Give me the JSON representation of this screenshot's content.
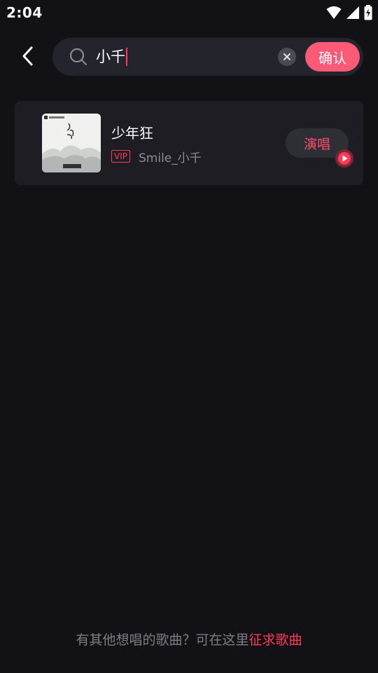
{
  "status_bar": {
    "time": "2:04"
  },
  "search": {
    "query": "小千",
    "confirm_label": "确认"
  },
  "results": [
    {
      "title": "少年狂",
      "vip_label": "VIP",
      "artist": "Smile_小千",
      "sing_label": "演唱"
    }
  ],
  "footer": {
    "prompt": "有其他想唱的歌曲？可在这里",
    "link": "征求歌曲"
  },
  "colors": {
    "accent": "#fd5a78",
    "link_red": "#ff3b5c",
    "background": "#111116",
    "card": "#1d1d23"
  }
}
